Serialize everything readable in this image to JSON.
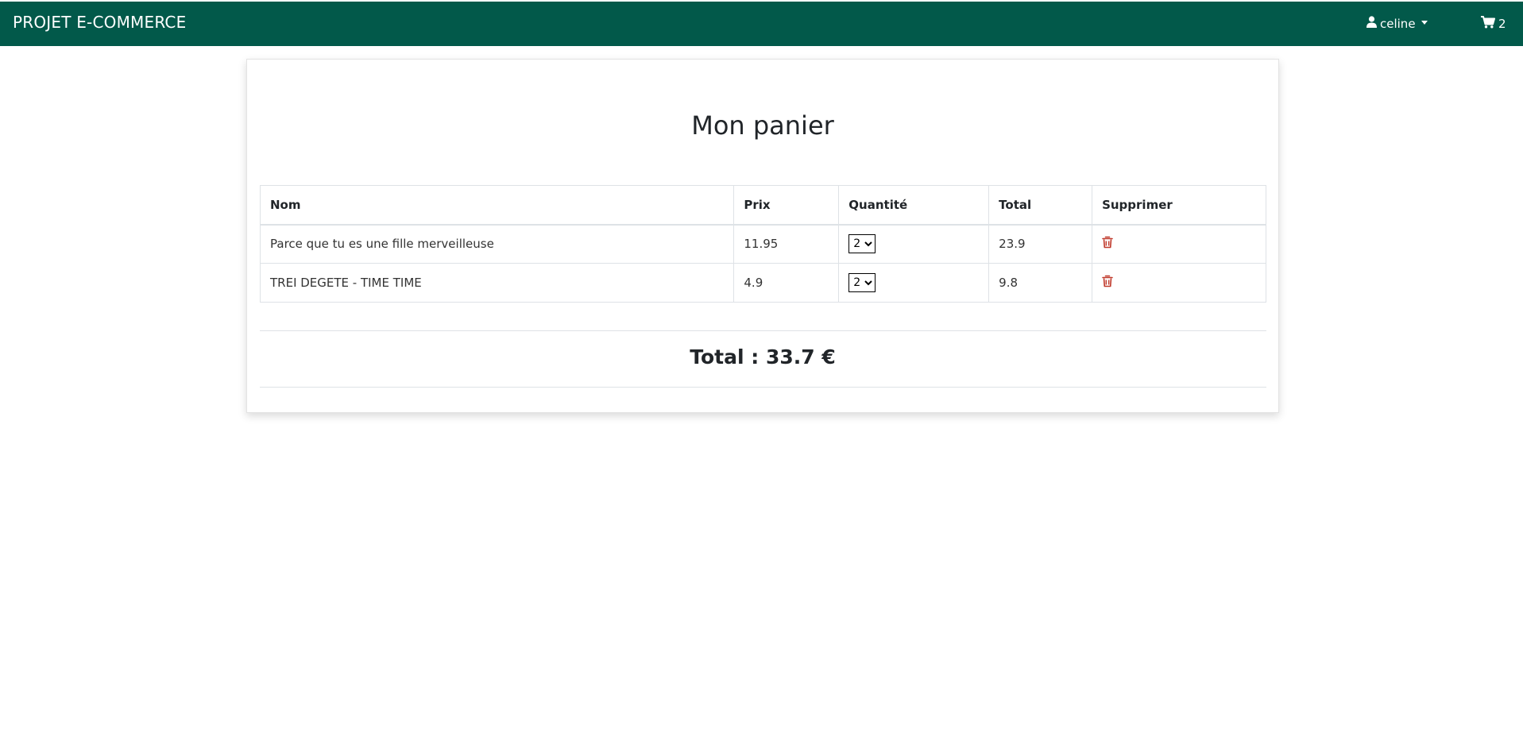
{
  "navbar": {
    "brand": "PROJET E-COMMERCE",
    "user_name": "celine",
    "cart_count": "2",
    "bg_color": "#02594a"
  },
  "cart": {
    "title": "Mon panier",
    "columns": [
      "Nom",
      "Prix",
      "Quantité",
      "Total",
      "Supprimer"
    ],
    "rows": [
      {
        "name": "Parce que tu es une fille merveilleuse",
        "price": "11.95",
        "quantity": "2",
        "total": "23.9"
      },
      {
        "name": "TREI DEGETE - TIME TIME",
        "price": "4.9",
        "quantity": "2",
        "total": "9.8"
      }
    ],
    "grand_total": "Total : 33.7 €",
    "delete_icon_color": "#c0392b"
  },
  "icons": {
    "user": "user-icon",
    "cart": "shopping-cart-icon",
    "delete": "trash-icon"
  }
}
